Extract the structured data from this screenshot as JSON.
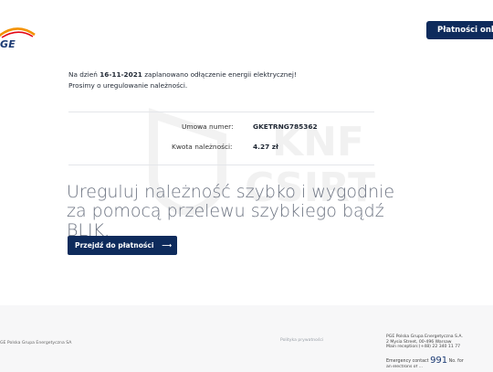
{
  "header": {
    "logo_text": "GE",
    "pay_button_label": "Płatności onl"
  },
  "watermark": {
    "line1": "KNF",
    "line2": "CSIRT"
  },
  "intro": {
    "line1_prefix": "Na dzień ",
    "date": "16-11-2021",
    "line1_suffix": " zaplanowano odłączenie energii elektrycznej!",
    "line2": "Prosimy o uregulowanie należności."
  },
  "details": {
    "contract_label": "Umowa numer:",
    "contract_value": "GKETRNG785362",
    "amount_label": "Kwota należności:",
    "amount_value": "4.27 zł"
  },
  "main": {
    "headline": "Ureguluj należność szybko i wygodnie za pomocą przelewu szybkiego bądź BLIK.",
    "pay_button_label": "Przejdź do płatności",
    "pay_button_arrow": "⟶"
  },
  "footer": {
    "company": "GE Polska Grupa Energetyczna SA",
    "privacy": "Polityka prywatności",
    "address_lines": [
      "PGE Polska Grupa Energetyczna S.A.",
      "2 Mysia Street, 00-496 Warsaw",
      "Main reception:(+48) 22 340 11 77"
    ],
    "emergency_prefix": "Emergency contact ",
    "emergency_number": "991",
    "emergency_suffix": " No. for",
    "emergency_cut": "an electrons of ..."
  },
  "colors": {
    "navy": "#0e2b5c",
    "logo_orange": "#f39200",
    "logo_red": "#e30613"
  }
}
